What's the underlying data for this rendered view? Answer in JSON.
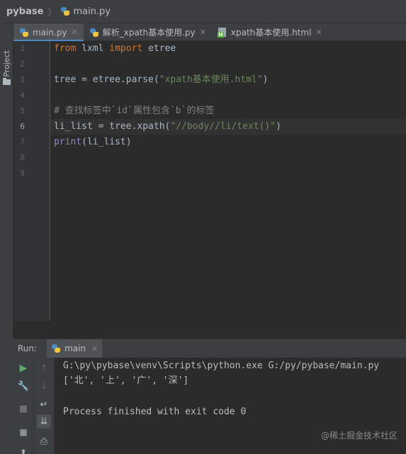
{
  "breadcrumb": {
    "project": "pybase",
    "file": "main.py"
  },
  "side_tab": {
    "label": "Project"
  },
  "tabs": [
    {
      "label": "main.py",
      "icon": "python-file-icon",
      "active": true
    },
    {
      "label": "解析_xpath基本使用.py",
      "icon": "python-file-icon",
      "active": false
    },
    {
      "label": "xpath基本使用.html",
      "icon": "html-file-icon",
      "active": false
    }
  ],
  "line_numbers": [
    "1",
    "2",
    "3",
    "4",
    "5",
    "6",
    "7",
    "8",
    "9"
  ],
  "code": {
    "l1_kw1": "from",
    "l1_mod": " lxml ",
    "l1_kw2": "import",
    "l1_name": " etree",
    "l3_a": "tree = etree.parse(",
    "l3_str": "\"xpath基本使用.html\"",
    "l3_b": ")",
    "l5_comment": "# 查找标签中`id`属性包含`b`的标签",
    "l6_a": "li_list = tree.xpath(",
    "l6_str": "\"//body//li/text()\"",
    "l6_b": ")",
    "l7_fn": "print",
    "l7_rest": "(li_list)"
  },
  "run": {
    "label": "Run:",
    "tab_label": "main",
    "output": [
      "G:\\py\\pybase\\venv\\Scripts\\python.exe G:/py/pybase/main.py",
      "['北', '上', '广', '深']",
      "",
      "Process finished with exit code 0"
    ]
  },
  "watermark": "@稀土掘金技术社区",
  "colors": {
    "keyword": "#cc7832",
    "string": "#6a8759",
    "comment": "#808080",
    "builtin": "#8888c6",
    "run_icon": "#59a869",
    "tab_underline": "#4a88c7"
  }
}
